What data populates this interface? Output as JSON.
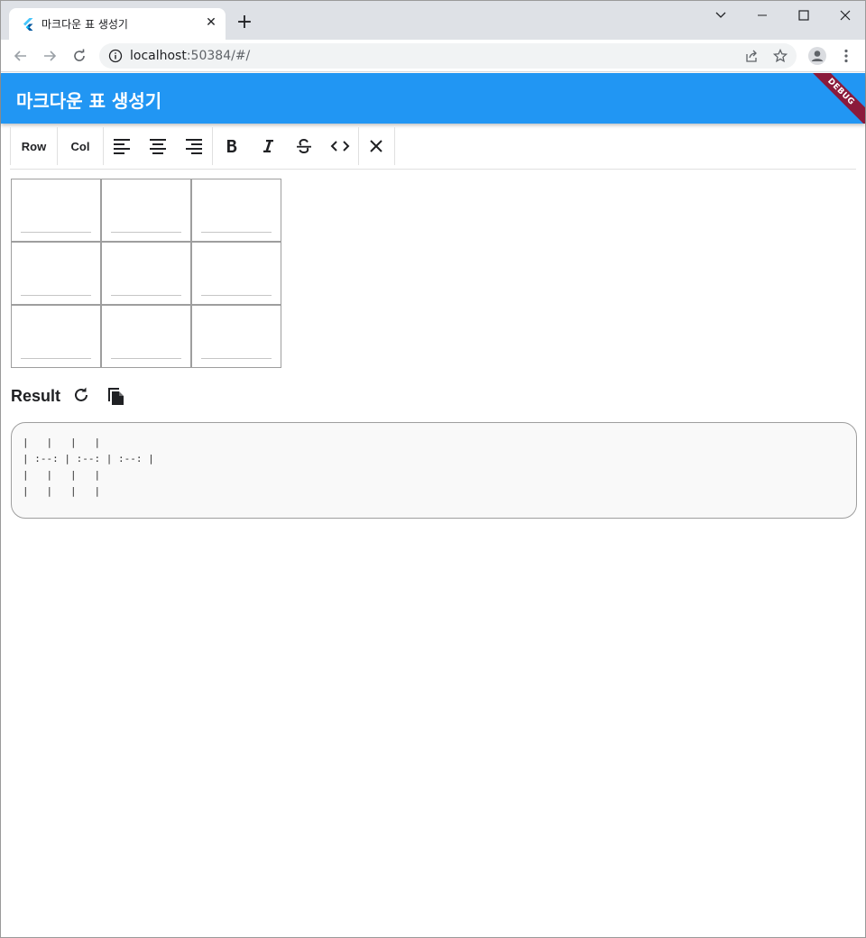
{
  "browser": {
    "tab_title": "마크다운 표 생성기",
    "tab_close": "✕",
    "new_tab": "+",
    "url_host": "localhost",
    "url_rest": ":50384/#/"
  },
  "app": {
    "title": "마크다운 표 생성기",
    "debug_banner": "DEBUG",
    "primary_color": "#2196f3"
  },
  "toolbar": {
    "row_label": "Row",
    "col_label": "Col",
    "icons": [
      "align-left-icon",
      "align-center-icon",
      "align-right-icon",
      "bold-icon",
      "italic-icon",
      "strikethrough-icon",
      "code-icon",
      "clear-icon"
    ]
  },
  "table": {
    "rows": 3,
    "cols": 3,
    "cells": [
      [
        "",
        "",
        ""
      ],
      [
        "",
        "",
        ""
      ],
      [
        "",
        "",
        ""
      ]
    ]
  },
  "result": {
    "label": "Result",
    "markdown": "|   |   |   |\n| :--: | :--: | :--: |\n|   |   |   |\n|   |   |   |"
  }
}
